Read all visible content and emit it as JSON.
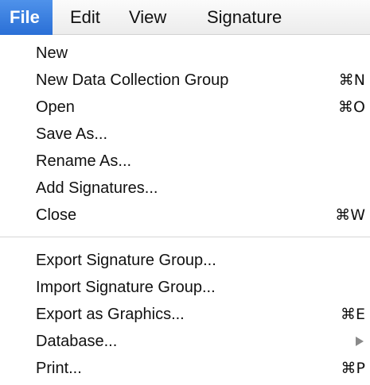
{
  "menubar": {
    "items": [
      {
        "label": "File",
        "active": true
      },
      {
        "label": "Edit"
      },
      {
        "label": "View"
      },
      {
        "label": "Signature"
      }
    ]
  },
  "menu": {
    "group1": [
      {
        "label": "New",
        "shortcut": ""
      },
      {
        "label": "New Data Collection Group",
        "shortcut": "⌘N"
      },
      {
        "label": "Open",
        "shortcut": "⌘O"
      },
      {
        "label": "Save As...",
        "shortcut": ""
      },
      {
        "label": "Rename As...",
        "shortcut": ""
      },
      {
        "label": "Add Signatures...",
        "shortcut": ""
      },
      {
        "label": "Close",
        "shortcut": "⌘W"
      }
    ],
    "group2": [
      {
        "label": "Export Signature Group...",
        "shortcut": ""
      },
      {
        "label": "Import Signature Group...",
        "shortcut": ""
      },
      {
        "label": "Export as Graphics...",
        "shortcut": "⌘E"
      },
      {
        "label": "Database...",
        "shortcut": "",
        "submenu_icon": "submenu-arrow-icon"
      },
      {
        "label": "Print...",
        "shortcut": "⌘P"
      }
    ]
  },
  "colors": {
    "active_menu_bg": "#2a6fd6",
    "active_menu_text": "#ffffff",
    "submenu_arrow": "#8a8a8a"
  }
}
